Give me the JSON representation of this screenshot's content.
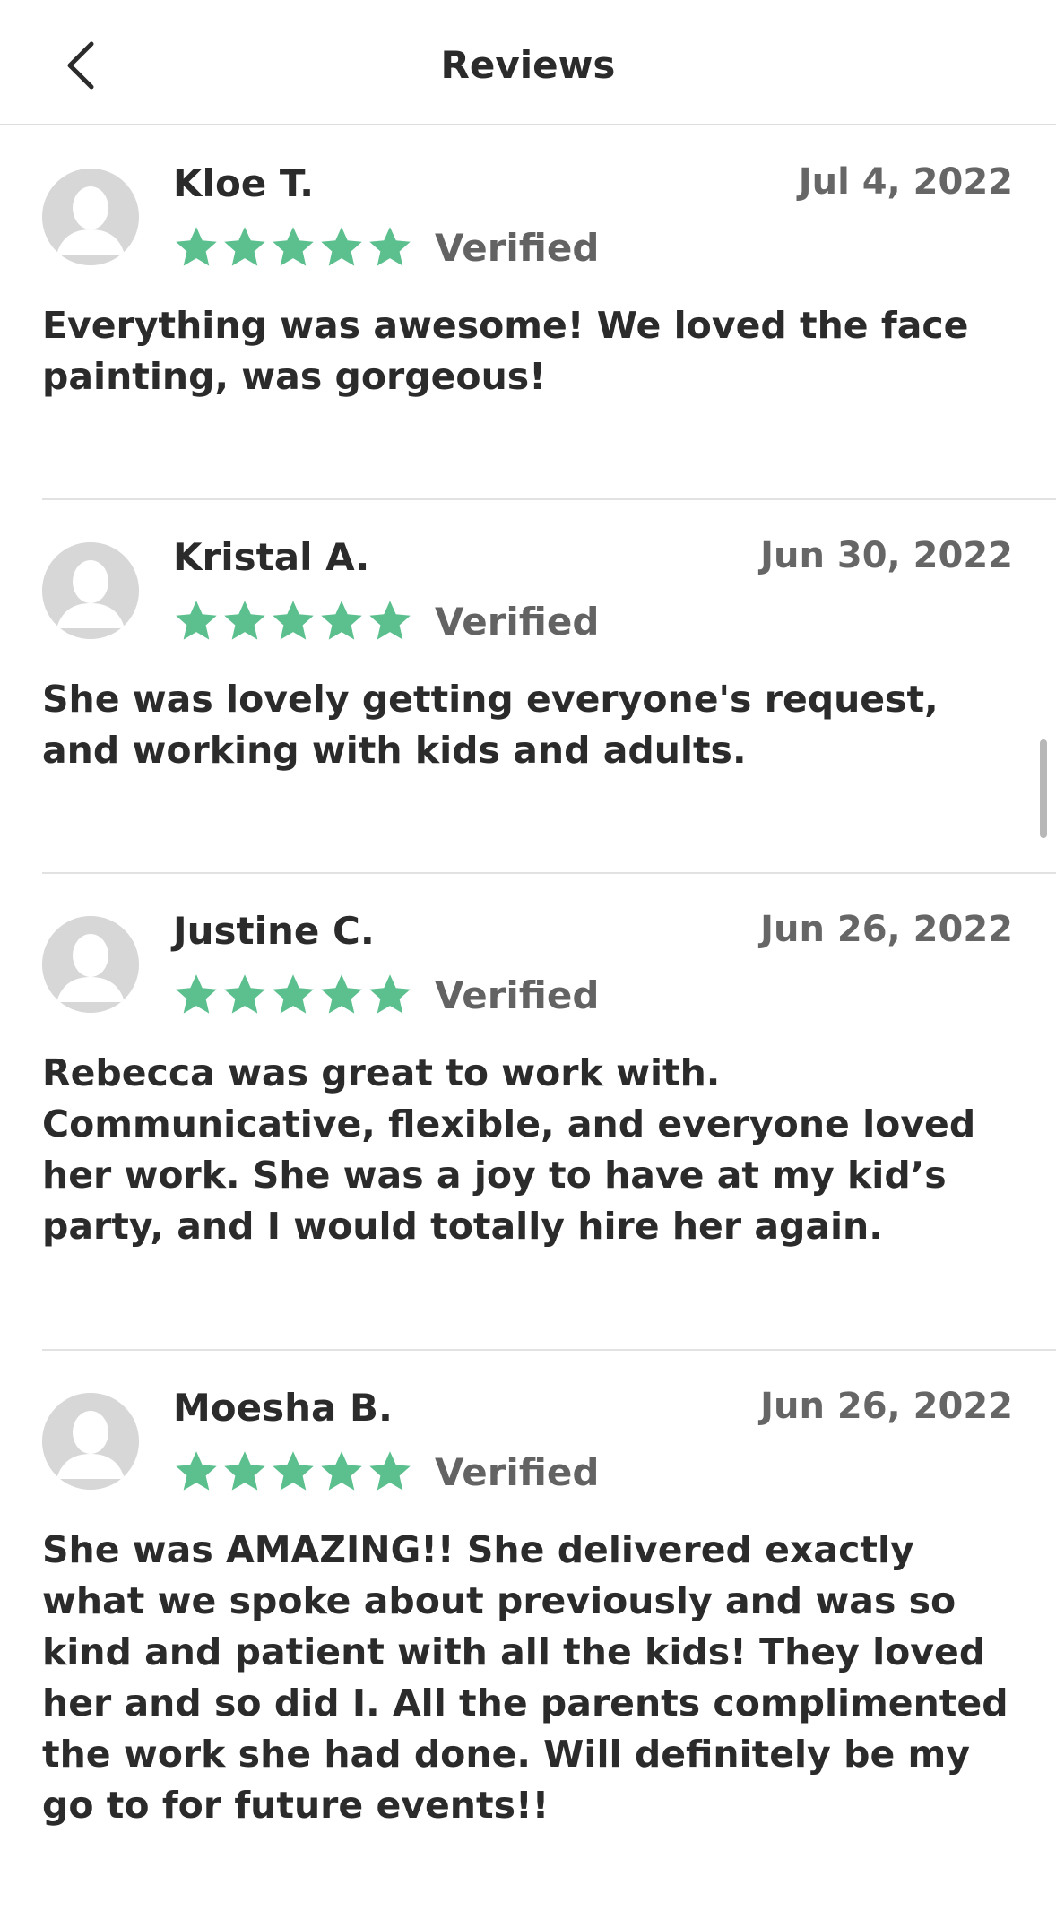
{
  "header": {
    "title": "Reviews",
    "back_icon": "chevron-left-icon"
  },
  "colors": {
    "star": "#5bbf8e",
    "avatar_bg": "#d7d7d7",
    "divider": "#e2e2e2"
  },
  "reviews": [
    {
      "name": "Kloe T.",
      "date": "Jul 4, 2022",
      "rating": 5,
      "badge": "Verified",
      "text": "Everything was awesome! We loved the face painting, was gorgeous!"
    },
    {
      "name": "Kristal A.",
      "date": "Jun 30, 2022",
      "rating": 5,
      "badge": "Verified",
      "text": "She was lovely getting everyone's request, and working with kids and adults."
    },
    {
      "name": "Justine C.",
      "date": "Jun 26, 2022",
      "rating": 5,
      "badge": "Verified",
      "text": "Rebecca was great to work with. Communicative, flexible, and everyone loved her work. She was a joy to have at my kid’s party, and I would totally hire her again."
    },
    {
      "name": "Moesha B.",
      "date": "Jun 26, 2022",
      "rating": 5,
      "badge": "Verified",
      "text": "She was AMAZING!! She delivered exactly what we spoke about previously and was so kind and patient with all the kids! They loved her and so did I. All the parents complimented the work she had done. Will definitely be my go to for future events!!"
    }
  ]
}
